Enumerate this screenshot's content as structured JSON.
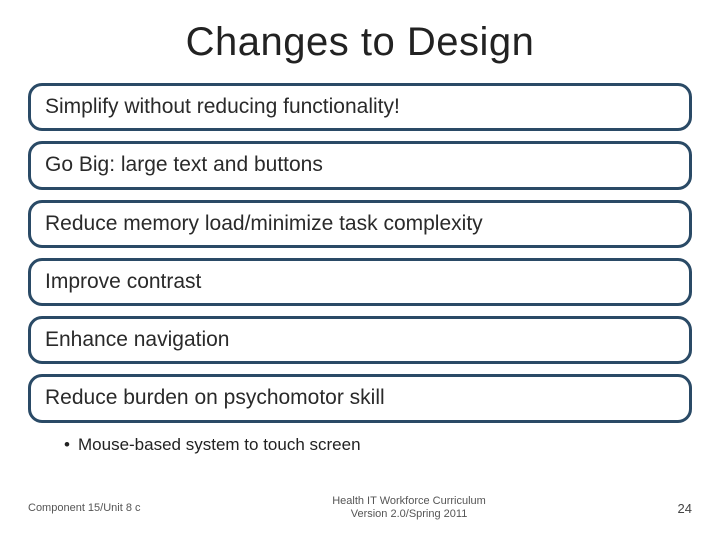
{
  "title": "Changes to Design",
  "pills": [
    "Simplify without reducing functionality!",
    "Go Big: large text and buttons",
    "Reduce memory load/minimize task complexity",
    "Improve contrast",
    "Enhance navigation",
    "Reduce burden on psychomotor skill"
  ],
  "subbullets": [
    "Mouse-based system to touch screen"
  ],
  "footer": {
    "left": "Component 15/Unit 8 c",
    "center_line1": "Health IT Workforce Curriculum",
    "center_line2": "Version 2.0/Spring 2011",
    "page": "24"
  }
}
